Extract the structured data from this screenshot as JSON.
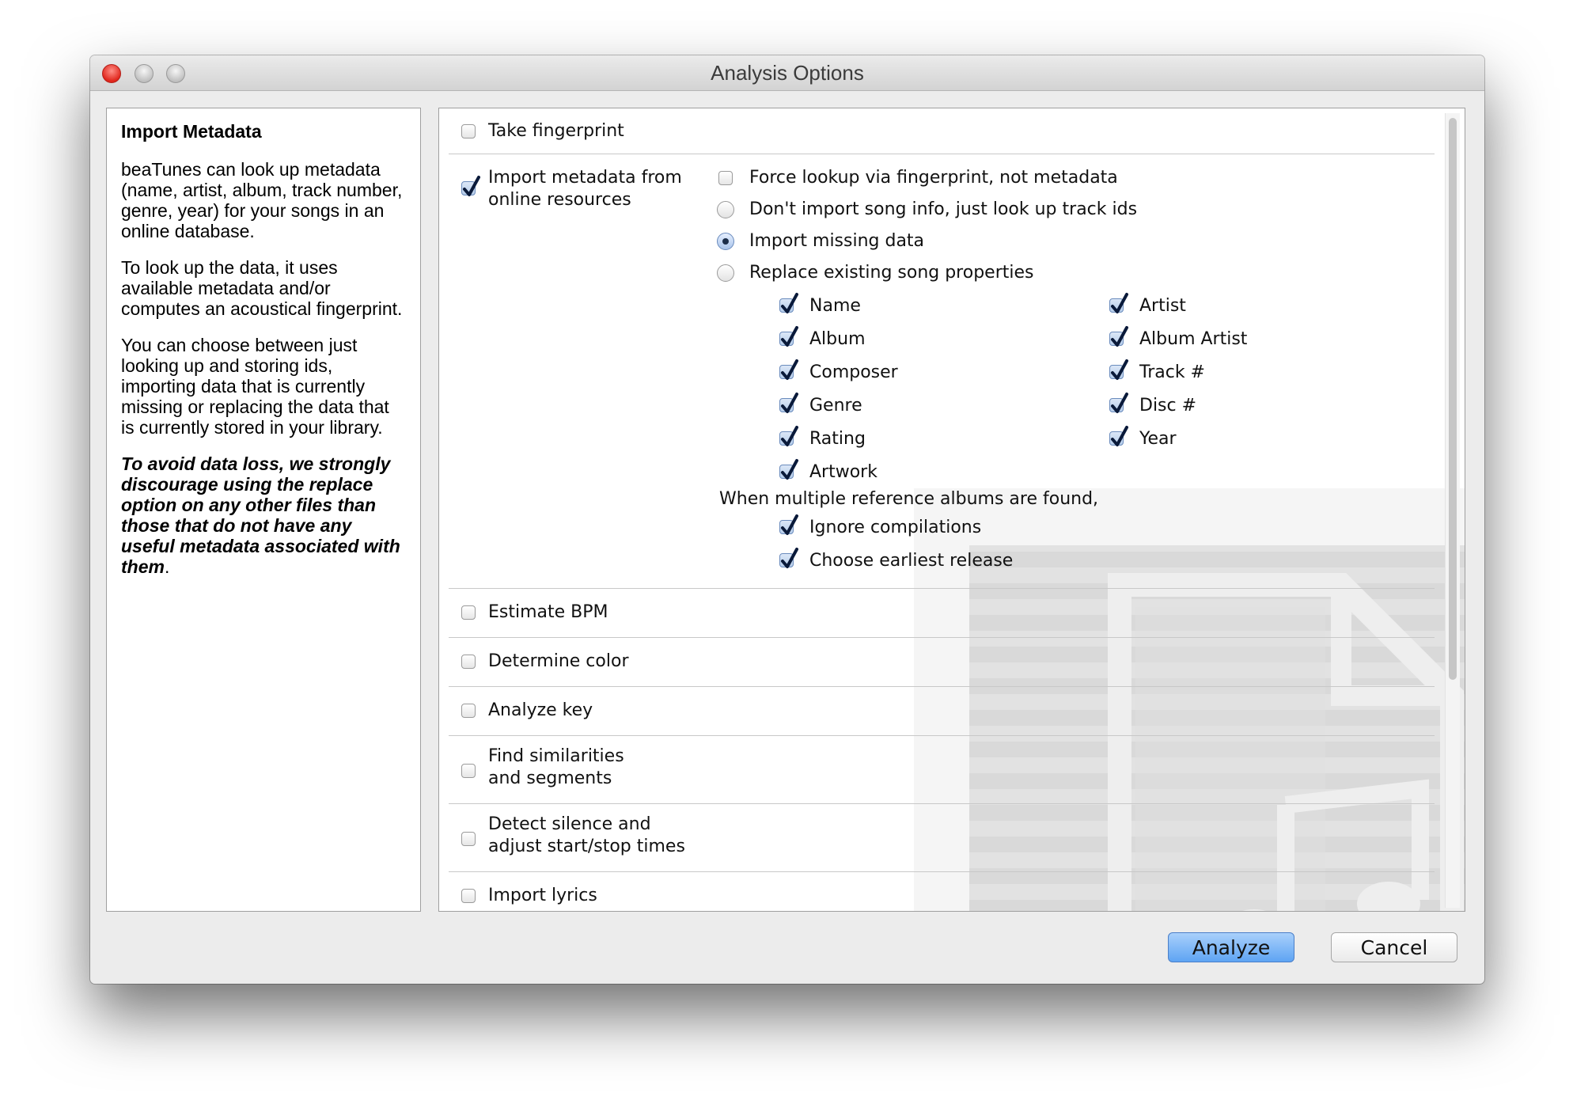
{
  "window": {
    "title": "Analysis Options"
  },
  "sidebar": {
    "heading": "Import Metadata",
    "paragraph1": "beaTunes can look up metadata (name, artist, album, track number, genre, year) for your songs in an online database.",
    "paragraph2": "To look up the data, it uses available metadata and/or computes an acoustical fingerprint.",
    "paragraph3": "You can choose between just looking up and storing ids, importing data that is currently missing or replacing the data that is currently stored in your library.",
    "warning": "To avoid data loss, we strongly discourage using the replace option on any other files than those that do not have any useful metadata associated with them",
    "warning_end": "."
  },
  "options": {
    "take_fingerprint": {
      "label": "Take fingerprint",
      "checked": false
    },
    "import_metadata": {
      "label_line1": "Import metadata from",
      "label_line2": "online resources",
      "checked": true
    },
    "force_lookup": {
      "label": "Force lookup via fingerprint, not metadata",
      "checked": false
    },
    "import_modes": [
      {
        "label": "Don't import song info, just look up track ids",
        "selected": false
      },
      {
        "label": "Import missing data",
        "selected": true
      },
      {
        "label": "Replace existing song properties",
        "selected": false
      }
    ],
    "properties_left": [
      {
        "label": "Name",
        "checked": true
      },
      {
        "label": "Album",
        "checked": true
      },
      {
        "label": "Composer",
        "checked": true
      },
      {
        "label": "Genre",
        "checked": true
      },
      {
        "label": "Rating",
        "checked": true
      },
      {
        "label": "Artwork",
        "checked": true
      }
    ],
    "properties_right": [
      {
        "label": "Artist",
        "checked": true
      },
      {
        "label": "Album Artist",
        "checked": true
      },
      {
        "label": "Track #",
        "checked": true
      },
      {
        "label": "Disc #",
        "checked": true
      },
      {
        "label": "Year",
        "checked": true
      }
    ],
    "multiple_albums_text": "When multiple reference albums are found,",
    "ignore_compilations": {
      "label": "Ignore compilations",
      "checked": true
    },
    "earliest_release": {
      "label": "Choose earliest release",
      "checked": true
    },
    "estimate_bpm": {
      "label": "Estimate BPM",
      "checked": false
    },
    "determine_color": {
      "label": "Determine color",
      "checked": false
    },
    "analyze_key": {
      "label": "Analyze key",
      "checked": false
    },
    "find_similarities": {
      "label_line1": "Find similarities",
      "label_line2": "and segments",
      "checked": false
    },
    "detect_silence": {
      "label_line1": "Detect silence and",
      "label_line2": "adjust start/stop times",
      "checked": false
    },
    "import_lyrics": {
      "label": "Import lyrics",
      "checked": false
    }
  },
  "buttons": {
    "analyze": "Analyze",
    "cancel": "Cancel"
  }
}
